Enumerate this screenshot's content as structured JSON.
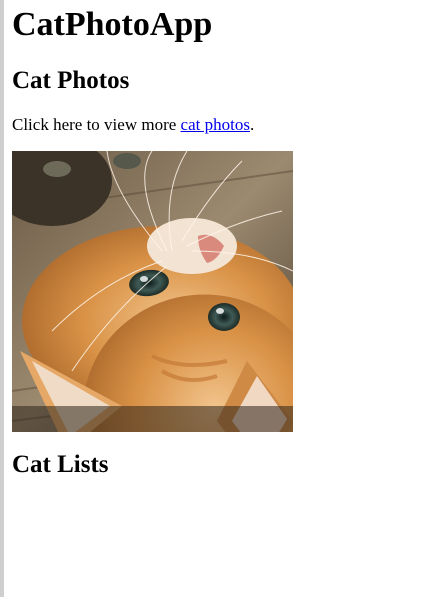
{
  "app": {
    "title": "CatPhotoApp"
  },
  "section_photos": {
    "heading": "Cat Photos",
    "text_before": "Click here to view more ",
    "link_text": "cat photos",
    "text_after": "."
  },
  "section_lists": {
    "heading": "Cat Lists"
  },
  "colors": {
    "link": "#0000ee",
    "cat_fur": "#d99246",
    "background": "#ffffff"
  }
}
